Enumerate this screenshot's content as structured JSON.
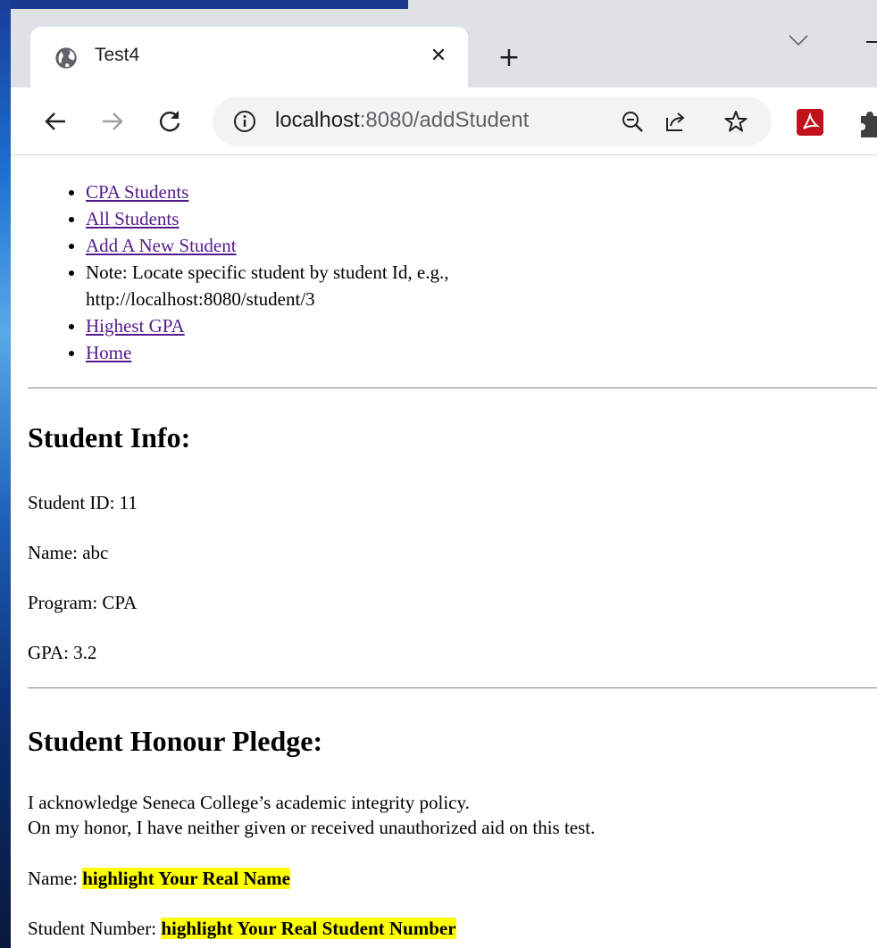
{
  "browser": {
    "tab_title": "Test4",
    "url_host": "localhost",
    "url_path": ":8080/addStudent"
  },
  "nav": {
    "items": [
      {
        "label": "CPA Students",
        "link": true
      },
      {
        "label": "All Students",
        "link": true
      },
      {
        "label": "Add A New Student",
        "link": true
      },
      {
        "label": "Note: Locate specific student by student Id, e.g., http://localhost:8080/student/3",
        "link": false
      },
      {
        "label": "Highest GPA",
        "link": true
      },
      {
        "label": "Home",
        "link": true
      }
    ]
  },
  "student_info": {
    "heading": "Student Info:",
    "id_line": "Student ID: 11",
    "name_line": "Name: abc",
    "program_line": "Program: CPA",
    "gpa_line": "GPA: 3.2"
  },
  "pledge": {
    "heading": "Student Honour Pledge:",
    "line1": "I acknowledge Seneca College’s academic integrity policy.",
    "line2": "On my honor, I have neither given or received unauthorized aid on this test.",
    "name_label": "Name: ",
    "name_value": "highlight Your Real Name",
    "number_label": "Student Number: ",
    "number_value": "highlight Your Real Student Number"
  },
  "colors": {
    "link": "#551a8b",
    "highlight": "#ffff00",
    "pdf_ext": "#c1121c"
  }
}
